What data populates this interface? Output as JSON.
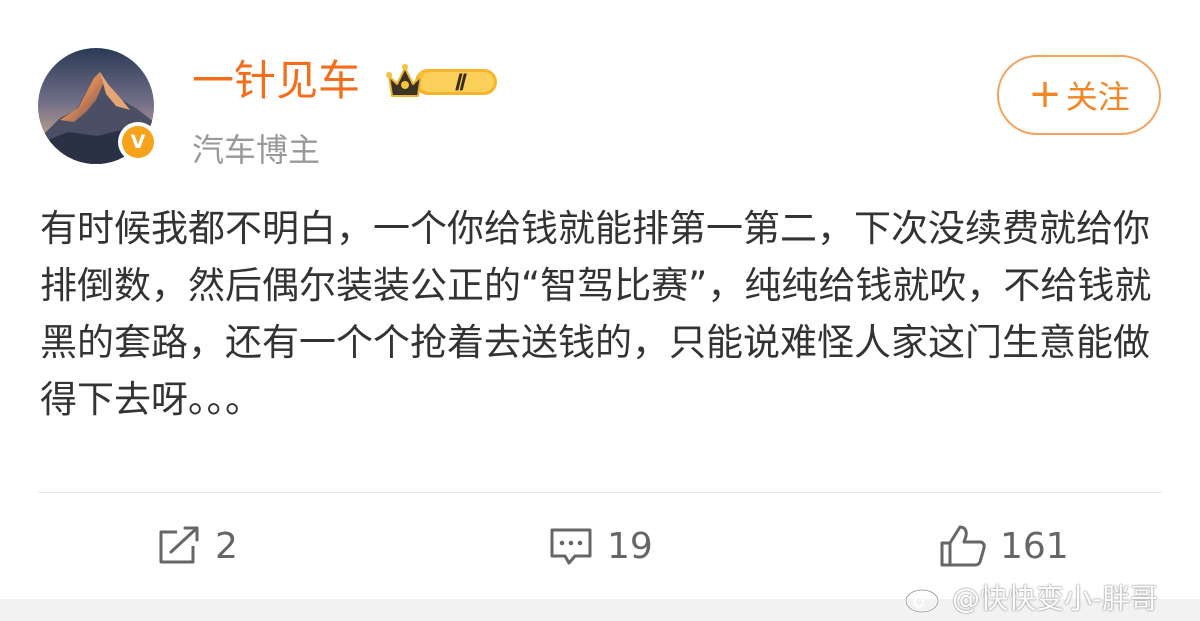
{
  "header": {
    "username": "一针见车",
    "level_badge": "Ⅱ",
    "subtitle": "汽车博主",
    "verify_mark": "V",
    "follow_label": "关注"
  },
  "post": {
    "text": "有时候我都不明白，一个你给钱就能排第一第二，下次没续费就给你排倒数，然后偶尔装装公正的“智驾比赛”，纯纯给钱就吹，不给钱就黑的套路，还有一个个抢着去送钱的，只能说难怪人家这门生意能做得下去呀。。。"
  },
  "actions": {
    "repost_count": "2",
    "comment_count": "19",
    "like_count": "161"
  },
  "watermark": {
    "text": "@快快变小-胖哥"
  },
  "colors": {
    "username": "#f56d1a",
    "follow_border": "#f5a25c",
    "verify_badge": "#f7a21b",
    "text": "#333333",
    "muted": "#999999"
  },
  "icons": {
    "repost": "repost-icon",
    "comment": "comment-icon",
    "like": "thumbs-up-icon",
    "follow": "plus-icon",
    "level": "crown-icon",
    "verify": "verified-v-icon",
    "watermark": "weibo-logo-icon"
  }
}
